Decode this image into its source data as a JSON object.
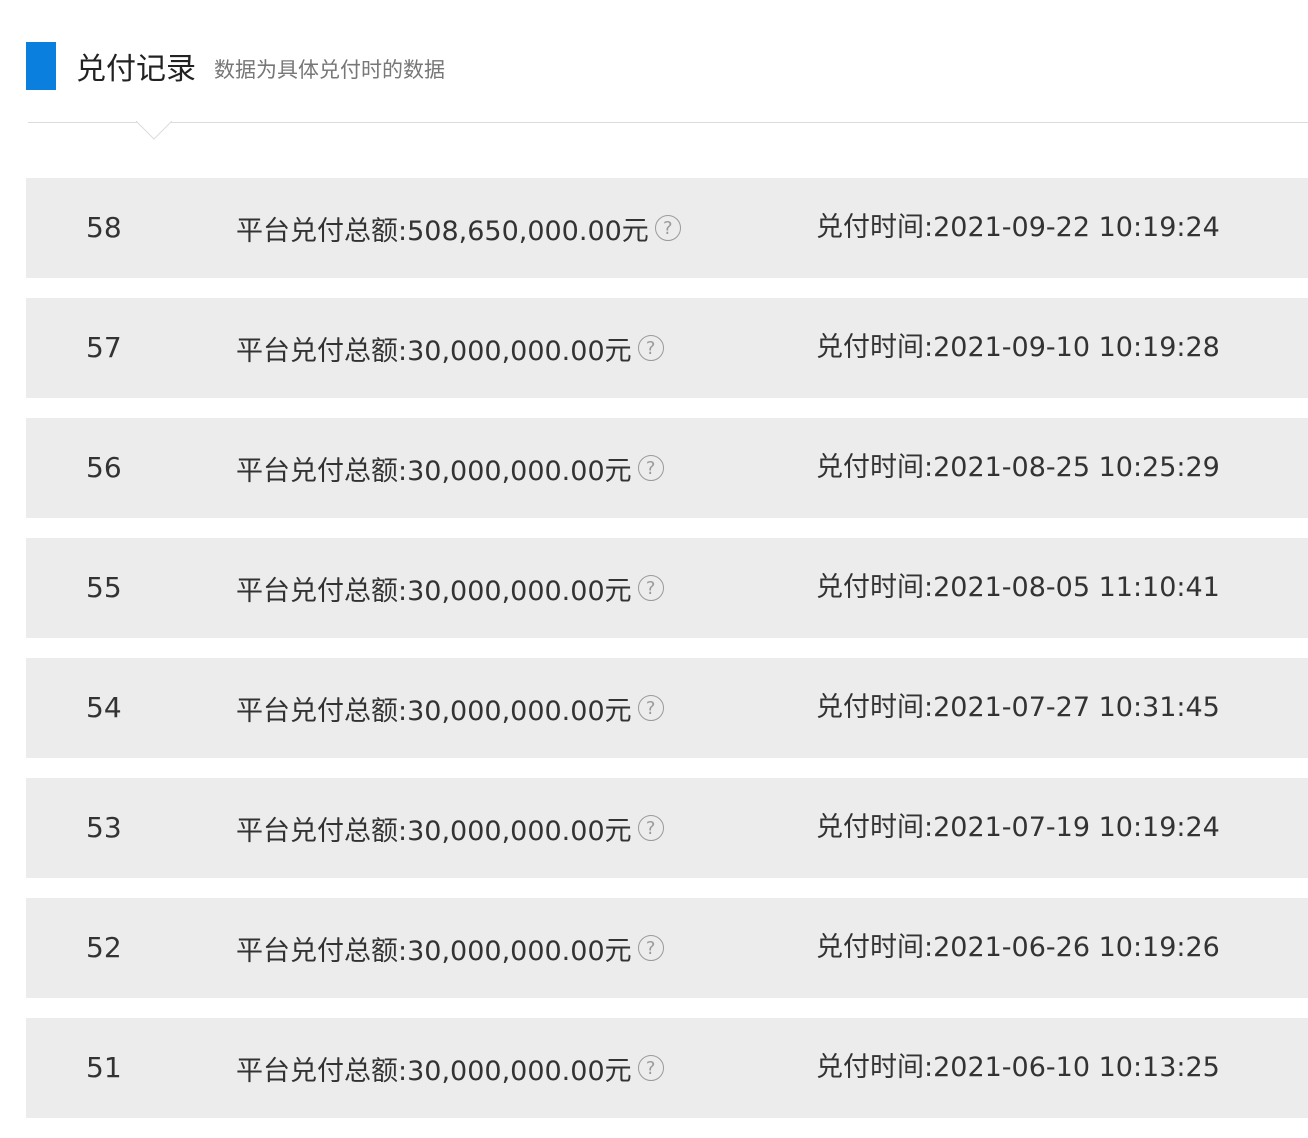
{
  "header": {
    "title": "兑付记录",
    "subtitle": "数据为具体兑付时的数据",
    "accent_color": "#0a7fde"
  },
  "records": [
    {
      "index": "58",
      "amount": "平台兑付总额:508,650,000.00元",
      "time": "兑付时间:2021-09-22 10:19:24",
      "help_icon": "question-circle-icon"
    },
    {
      "index": "57",
      "amount": "平台兑付总额:30,000,000.00元",
      "time": "兑付时间:2021-09-10 10:19:28",
      "help_icon": "question-circle-icon"
    },
    {
      "index": "56",
      "amount": "平台兑付总额:30,000,000.00元",
      "time": "兑付时间:2021-08-25 10:25:29",
      "help_icon": "question-circle-icon"
    },
    {
      "index": "55",
      "amount": "平台兑付总额:30,000,000.00元",
      "time": "兑付时间:2021-08-05 11:10:41",
      "help_icon": "question-circle-icon"
    },
    {
      "index": "54",
      "amount": "平台兑付总额:30,000,000.00元",
      "time": "兑付时间:2021-07-27 10:31:45",
      "help_icon": "question-circle-icon"
    },
    {
      "index": "53",
      "amount": "平台兑付总额:30,000,000.00元",
      "time": "兑付时间:2021-07-19 10:19:24",
      "help_icon": "question-circle-icon"
    },
    {
      "index": "52",
      "amount": "平台兑付总额:30,000,000.00元",
      "time": "兑付时间:2021-06-26 10:19:26",
      "help_icon": "question-circle-icon"
    },
    {
      "index": "51",
      "amount": "平台兑付总额:30,000,000.00元",
      "time": "兑付时间:2021-06-10 10:13:25",
      "help_icon": "question-circle-icon"
    }
  ]
}
